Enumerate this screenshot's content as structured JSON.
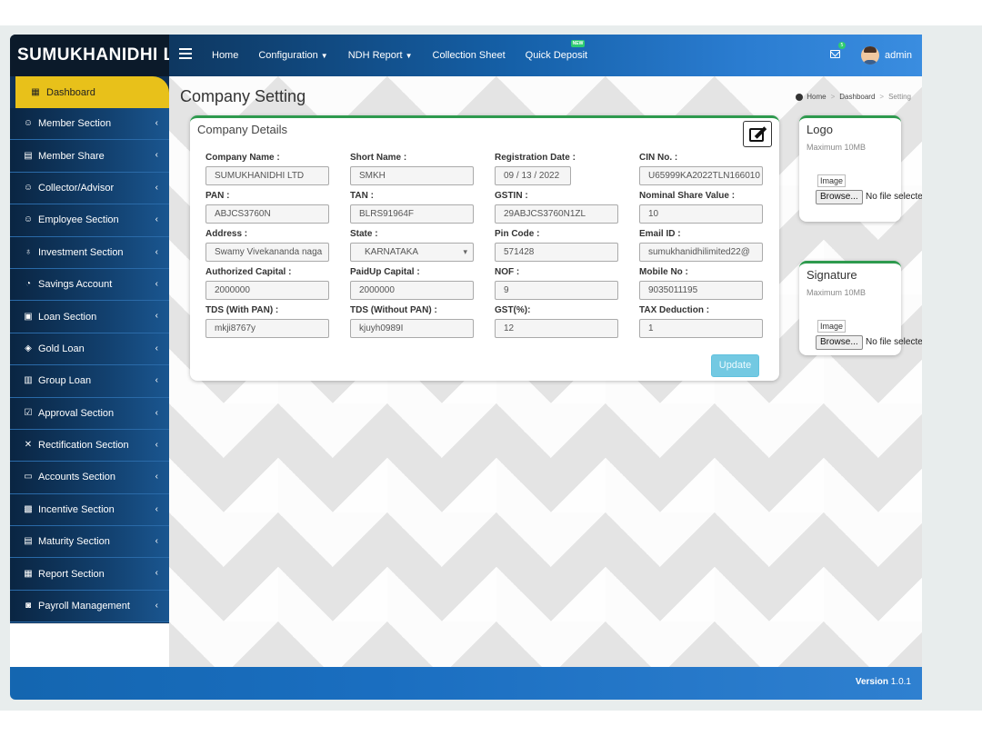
{
  "brand": "SUMUKHANIDHI L",
  "nav": [
    {
      "label": "Home",
      "caret": false,
      "badge": ""
    },
    {
      "label": "Configuration",
      "caret": true,
      "badge": ""
    },
    {
      "label": "NDH Report",
      "caret": true,
      "badge": ""
    },
    {
      "label": "Collection Sheet",
      "caret": false,
      "badge": ""
    },
    {
      "label": "Quick Deposit",
      "caret": false,
      "badge": "NEW"
    }
  ],
  "header": {
    "mail_count": "5",
    "user": "admin"
  },
  "sidebar": {
    "active": "Dashboard",
    "items": [
      {
        "label": "Member Section",
        "icon": "user-icon"
      },
      {
        "label": "Member Share",
        "icon": "document-icon"
      },
      {
        "label": "Collector/Advisor",
        "icon": "user-icon"
      },
      {
        "label": "Employee Section",
        "icon": "user-icon"
      },
      {
        "label": "Investment Section",
        "icon": "money-bag-icon"
      },
      {
        "label": "Savings Account",
        "icon": "piggy-bank-icon"
      },
      {
        "label": "Loan Section",
        "icon": "loan-icon"
      },
      {
        "label": "Gold Loan",
        "icon": "gold-icon"
      },
      {
        "label": "Group Loan",
        "icon": "group-icon"
      },
      {
        "label": "Approval Section",
        "icon": "approval-icon"
      },
      {
        "label": "Rectification Section",
        "icon": "tools-icon"
      },
      {
        "label": "Accounts Section",
        "icon": "accounts-icon"
      },
      {
        "label": "Incentive Section",
        "icon": "incentive-icon"
      },
      {
        "label": "Maturity Section",
        "icon": "maturity-icon"
      },
      {
        "label": "Report Section",
        "icon": "report-icon"
      },
      {
        "label": "Payroll Management",
        "icon": "payroll-icon"
      }
    ]
  },
  "page": {
    "title": "Company Setting",
    "breadcrumb": [
      "Home",
      "Dashboard",
      "Setting"
    ]
  },
  "company": {
    "card_title": "Company Details",
    "fields": [
      {
        "label": "Company Name :",
        "value": "SUMUKHANIDHI LTD"
      },
      {
        "label": "Short Name :",
        "value": "SMKH"
      },
      {
        "label": "Registration Date :",
        "value": "09 / 13 / 2022"
      },
      {
        "label": "CIN No. :",
        "value": "U65999KA2022TLN166010"
      },
      {
        "label": "PAN :",
        "value": "ABJCS3760N"
      },
      {
        "label": "TAN :",
        "value": "BLRS91964F"
      },
      {
        "label": "GSTIN :",
        "value": "29ABJCS3760N1ZL"
      },
      {
        "label": "Nominal Share Value :",
        "value": "10"
      },
      {
        "label": "Address :",
        "value": "Swamy Vivekananda naga"
      },
      {
        "label": "State :",
        "value": "KARNATAKA"
      },
      {
        "label": "Pin Code :",
        "value": "571428"
      },
      {
        "label": "Email ID :",
        "value": "sumukhanidhilimited22@"
      },
      {
        "label": "Authorized Capital :",
        "value": "2000000"
      },
      {
        "label": "PaidUp Capital :",
        "value": "2000000"
      },
      {
        "label": "NOF :",
        "value": "9"
      },
      {
        "label": "Mobile No :",
        "value": "9035011195"
      },
      {
        "label": "TDS (With PAN) :",
        "value": "mkji8767y"
      },
      {
        "label": "TDS (Without PAN) :",
        "value": "kjuyh0989I"
      },
      {
        "label": "GST(%):",
        "value": "12"
      },
      {
        "label": "TAX Deduction :",
        "value": "1"
      }
    ],
    "update_label": "Update"
  },
  "logo_card": {
    "title": "Logo",
    "subtitle": "Maximum 10MB",
    "image_label": "Image",
    "browse_label": "Browse...",
    "nofile": "No file selected."
  },
  "signature_card": {
    "title": "Signature",
    "subtitle": "Maximum 10MB",
    "image_label": "Image",
    "browse_label": "Browse...",
    "nofile": "No file selected."
  },
  "footer": {
    "version_label": "Version",
    "version": "1.0.1"
  },
  "colors": {
    "accent": "#e8c11a",
    "card_border": "#2e9a4e",
    "update_button": "#5bc0de"
  }
}
